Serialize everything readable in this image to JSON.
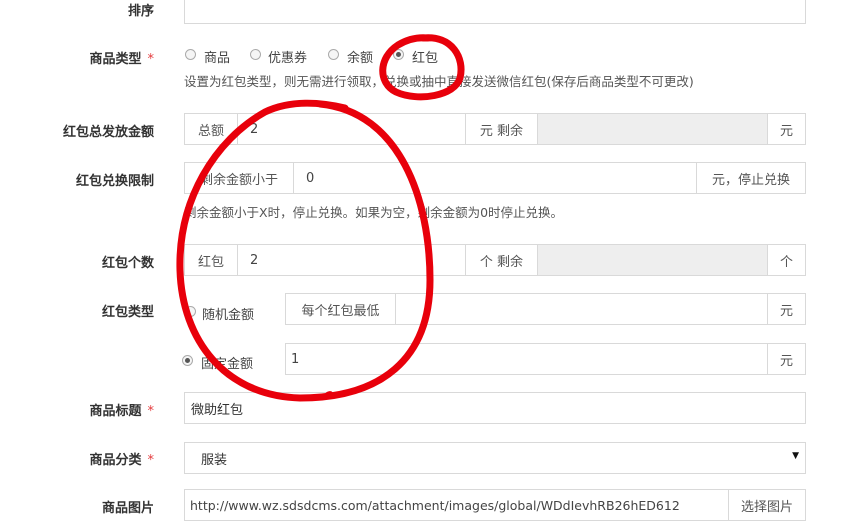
{
  "form": {
    "sort": {
      "label": "排序"
    },
    "product_type": {
      "label": "商品类型",
      "required_mark": "*",
      "options": [
        "商品",
        "优惠券",
        "余额",
        "红包"
      ],
      "selected": "红包",
      "help": "设置为红包类型，则无需进行领取，兑换或抽中直接发送微信红包(保存后商品类型不可更改)"
    },
    "redpacket_total": {
      "label": "红包总发放金额",
      "prefix": "总额",
      "value": "2",
      "middle": "元 剩余",
      "remaining": "",
      "suffix": "元"
    },
    "redpacket_limit": {
      "label": "红包兑换限制",
      "prefix": "剩余金额小于",
      "value": "0",
      "suffix": "元，停止兑换",
      "help": "剩余金额小于X时，停止兑换。如果为空，剩余金额为0时停止兑换。"
    },
    "redpacket_count": {
      "label": "红包个数",
      "prefix": "红包",
      "value": "2",
      "middle": "个 剩余",
      "remaining": "",
      "suffix": "个"
    },
    "redpacket_type": {
      "label": "红包类型",
      "random": {
        "label": "随机金额",
        "prefix": "每个红包最低",
        "value": "",
        "suffix": "元"
      },
      "fixed": {
        "label": "固定金额",
        "value": "1",
        "suffix": "元"
      },
      "selected": "固定金额"
    },
    "title": {
      "label": "商品标题",
      "required_mark": "*",
      "value": "微助红包"
    },
    "category": {
      "label": "商品分类",
      "required_mark": "*",
      "value": "服装"
    },
    "image": {
      "label": "商品图片",
      "value": "http://www.wz.sdsdcms.com/attachment/images/global/WDdIevhRB26hED612",
      "button": "选择图片"
    }
  },
  "annotation_color": "#e8000b"
}
